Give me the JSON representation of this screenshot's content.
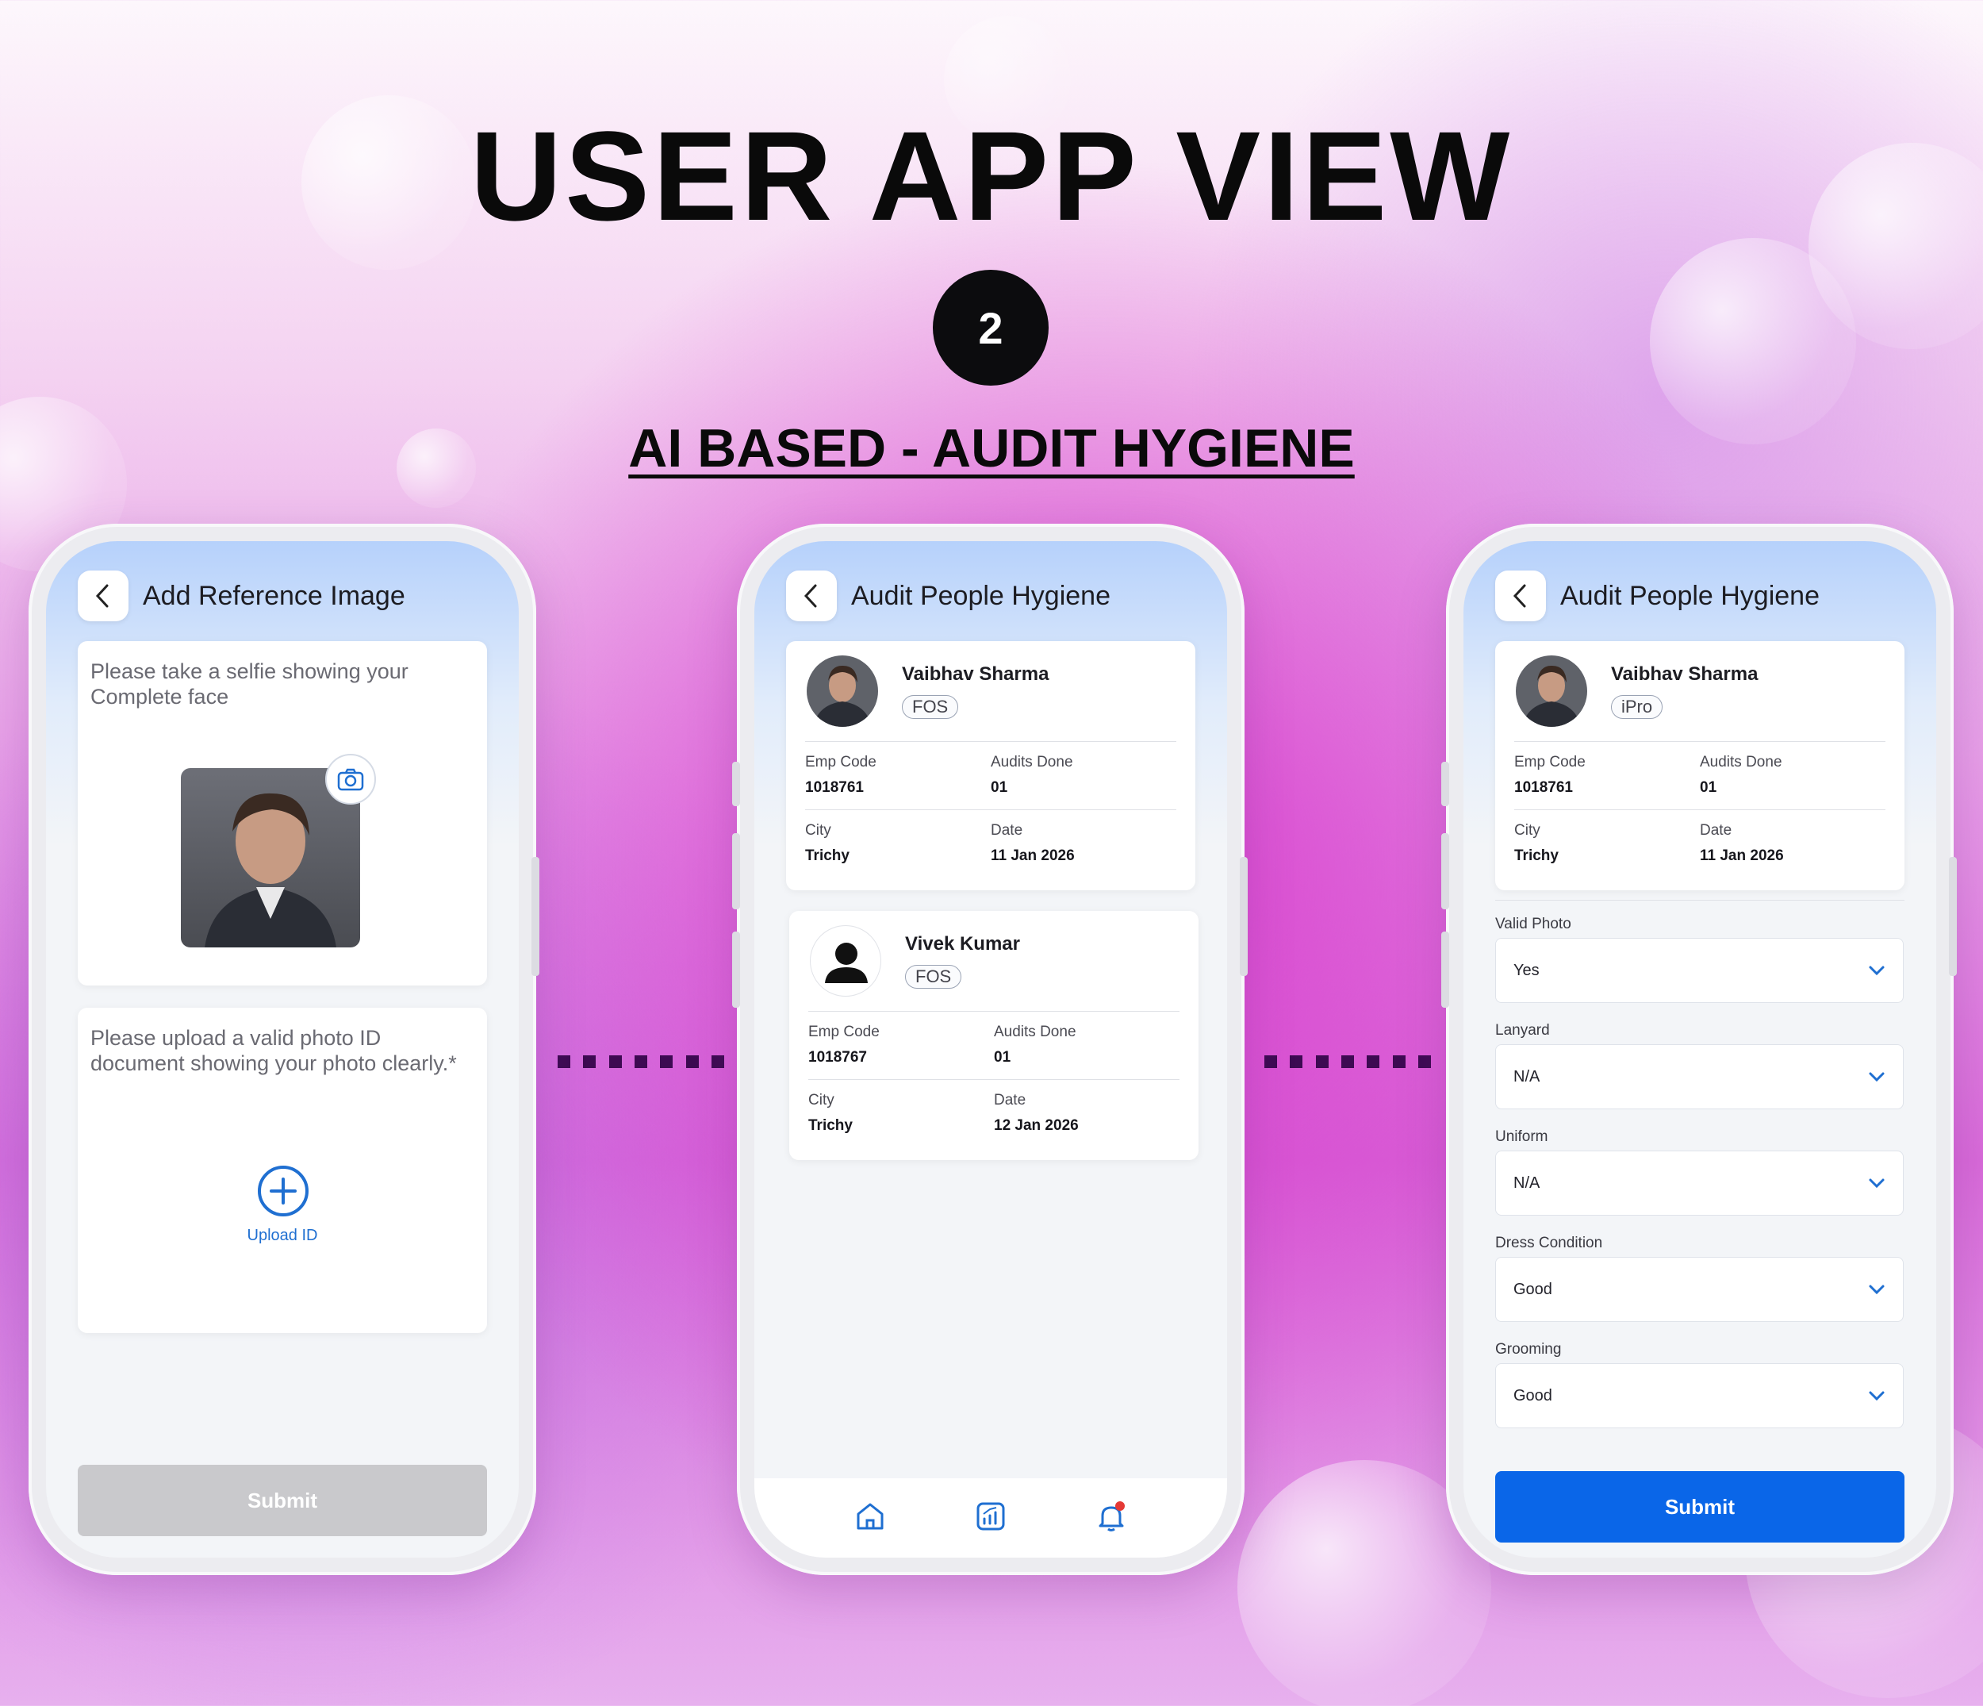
{
  "header": {
    "title": "USER APP VIEW",
    "step": "2",
    "subtitle": "AI BASED - AUDIT HYGIENE"
  },
  "screen1": {
    "title": "Add Reference Image",
    "selfie_prompt": "Please take a selfie showing your Complete face",
    "id_prompt": "Please upload a valid photo ID document showing your photo clearly.*",
    "upload_label": "Upload ID",
    "submit_label": "Submit"
  },
  "screen2": {
    "title": "Audit People Hygiene",
    "cards": [
      {
        "name": "Vaibhav Sharma",
        "role": "FOS",
        "emp_code_label": "Emp Code",
        "emp_code": "1018761",
        "audits_label": "Audits Done",
        "audits": "01",
        "city_label": "City",
        "city": "Trichy",
        "date_label": "Date",
        "date": "11 Jan 2026"
      },
      {
        "name": "Vivek Kumar",
        "role": "FOS",
        "emp_code_label": "Emp Code",
        "emp_code": "1018767",
        "audits_label": "Audits Done",
        "audits": "01",
        "city_label": "City",
        "city": "Trichy",
        "date_label": "Date",
        "date": "12 Jan 2026"
      }
    ],
    "nav": [
      "home-icon",
      "analytics-icon",
      "notification-bell-icon"
    ]
  },
  "screen3": {
    "title": "Audit People Hygiene",
    "card": {
      "name": "Vaibhav Sharma",
      "role": "iPro",
      "emp_code_label": "Emp Code",
      "emp_code": "1018761",
      "audits_label": "Audits Done",
      "audits": "01",
      "city_label": "City",
      "city": "Trichy",
      "date_label": "Date",
      "date": "11 Jan 2026"
    },
    "fields": [
      {
        "label": "Valid Photo",
        "value": "Yes"
      },
      {
        "label": "Lanyard",
        "value": "N/A"
      },
      {
        "label": "Uniform",
        "value": "N/A"
      },
      {
        "label": "Dress Condition",
        "value": "Good"
      },
      {
        "label": "Grooming",
        "value": "Good"
      }
    ],
    "submit_label": "Submit"
  },
  "colors": {
    "primary": "#0a66e8",
    "disabled": "#c9c9cc",
    "accent_blue": "#1f6fd1",
    "dots": "#3d0a52",
    "notify": "#e53935"
  }
}
